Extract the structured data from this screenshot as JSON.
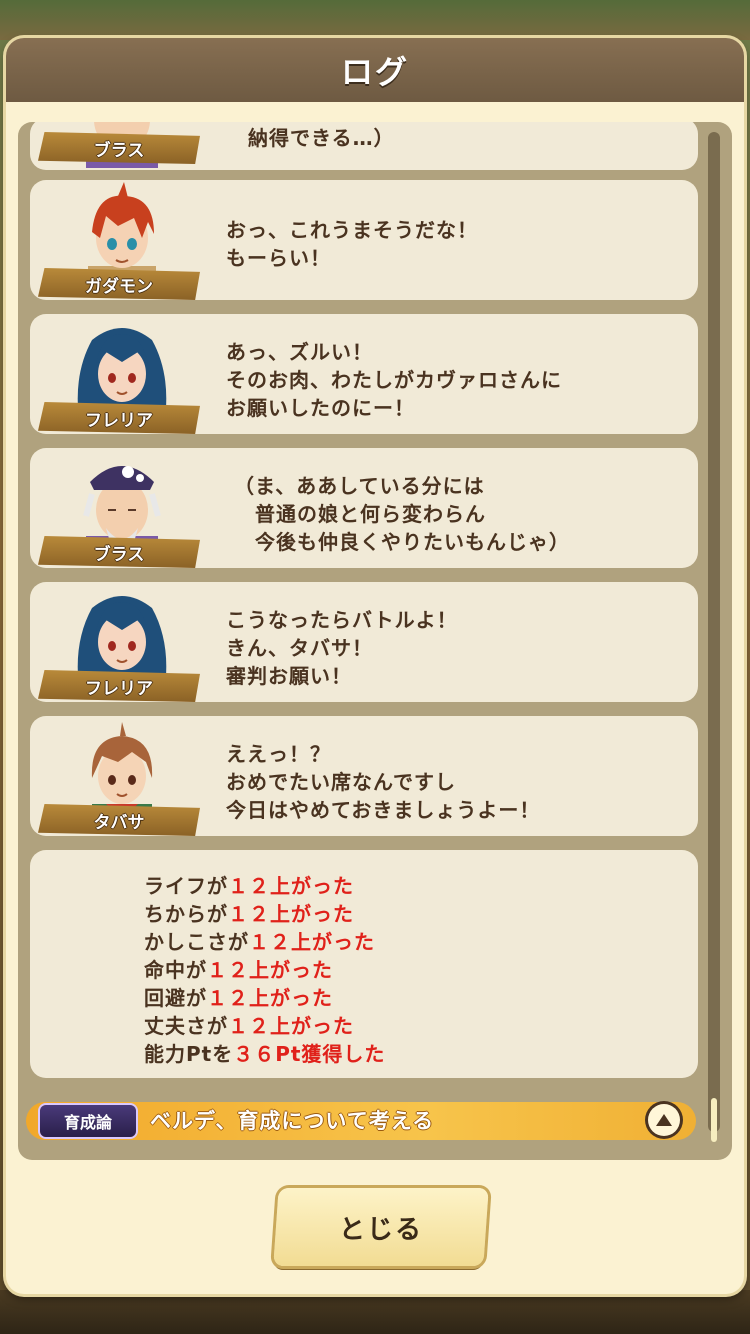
{
  "dialog": {
    "title": "ログ",
    "close_label": "とじる"
  },
  "entries": [
    {
      "name": "ブラス",
      "text": "納得できる…）"
    },
    {
      "name": "ガダモン",
      "text": "おっ、これうまそうだな！\nもーらい！"
    },
    {
      "name": "フレリア",
      "text": "あっ、ズルい！\nそのお肉、わたしがカヴァロさんに\nお願いしたのにー！"
    },
    {
      "name": "ブラス",
      "text": "（ま、ああしている分には\n　普通の娘と何ら変わらん\n　今後も仲良くやりたいもんじゃ）"
    },
    {
      "name": "フレリア",
      "text": "こうなったらバトルよ！\nきん、タバサ！\n審判お願い！"
    },
    {
      "name": "タバサ",
      "text": "ええっ！？\nおめでたい席なんですし\n今日はやめておきましょうよー！"
    }
  ],
  "stats": [
    {
      "label": "ライフが",
      "value": "１２上がった"
    },
    {
      "label": "ちからが",
      "value": "１２上がった"
    },
    {
      "label": "かしこさが",
      "value": "１２上がった"
    },
    {
      "label": "命中が",
      "value": "１２上がった"
    },
    {
      "label": "回避が",
      "value": "１２上がった"
    },
    {
      "label": "丈夫さが",
      "value": "１２上がった"
    },
    {
      "label": "能力Ptを",
      "value": "３６Pt獲得した"
    }
  ],
  "chapter": {
    "badge": "育成論",
    "title": "ベルデ、育成について考える"
  },
  "colors": {
    "header": "#7a644a",
    "highlight": "#e0211a",
    "text": "#4a3320"
  }
}
